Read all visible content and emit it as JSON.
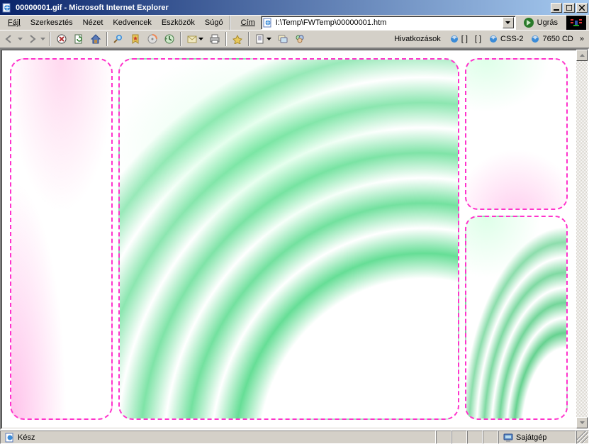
{
  "window": {
    "title": "00000001.gif - Microsoft Internet Explorer"
  },
  "menu": {
    "file": "Fájl",
    "edit": "Szerkesztés",
    "view": "Nézet",
    "favorites": "Kedvencek",
    "tools": "Eszközök",
    "help": "Súgó"
  },
  "address": {
    "label": "Cím",
    "value": "I:\\Temp\\FWTemp\\00000001.htm",
    "go_label": "Ugrás"
  },
  "links": {
    "label": "Hivatkozások",
    "item1": "[ ]",
    "item2": "[ ]",
    "item3": "CSS-2",
    "item4": "7650 CD"
  },
  "status": {
    "ready": "Kész",
    "zone": "Sajátgép"
  }
}
